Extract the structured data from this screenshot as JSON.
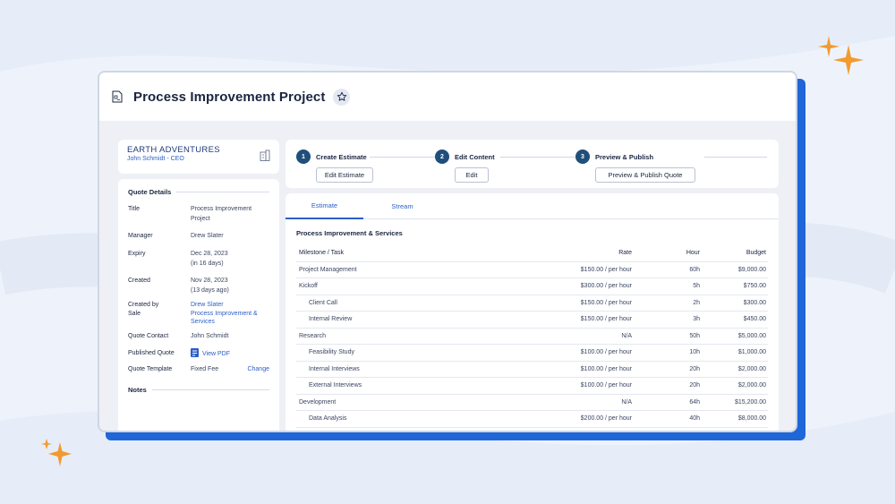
{
  "page": {
    "title": "Process Improvement Project",
    "colors": {
      "accent": "#2b5fc7",
      "shadow": "#1f66d9",
      "sparkle": "#f29a2e",
      "step": "#1f4f7a"
    }
  },
  "company": {
    "name": "EARTH ADVENTURES",
    "contact": "John Schmidt - CEO"
  },
  "quote_details": {
    "heading": "Quote Details",
    "rows": [
      {
        "label": "Title",
        "value": "Process Improvement",
        "value2": "Project"
      },
      {
        "label": "Manager",
        "value": "Drew Slater"
      },
      {
        "label": "Expiry",
        "value": "Dec 28, 2023",
        "value2": "(in 16 days)"
      },
      {
        "label": "Created",
        "value": "Nov 28, 2023",
        "value2": "(13 days ago)"
      },
      {
        "label": "Created by",
        "value": "Drew Slater"
      },
      {
        "label": "Sale",
        "value": "Process Improvement &",
        "value2": "Services"
      },
      {
        "label": "Quote Contact",
        "value": "John Schmidt"
      },
      {
        "label": "Published Quote",
        "value": "View PDF"
      },
      {
        "label": "Quote Template",
        "value": "Fixed Fee",
        "action": "Change"
      }
    ],
    "notes_heading": "Notes"
  },
  "steps": [
    {
      "num": "1",
      "title": "Create Estimate",
      "button": "Edit Estimate"
    },
    {
      "num": "2",
      "title": "Edit Content",
      "button": "Edit"
    },
    {
      "num": "3",
      "title": "Preview & Publish",
      "button": "Preview & Publish Quote"
    }
  ],
  "tabs": [
    {
      "label": "Estimate",
      "active": true
    },
    {
      "label": "Stream",
      "active": false
    }
  ],
  "estimate": {
    "title": "Process Improvement & Services",
    "columns": [
      "Milestone / Task",
      "Rate",
      "Hour",
      "Budget"
    ],
    "rows": [
      {
        "task": "Project Management",
        "rate": "$150.00 / per hour",
        "hour": "60h",
        "budget": "$9,000.00",
        "indent": false
      },
      {
        "task": "Kickoff",
        "rate": "$300.00 / per hour",
        "hour": "5h",
        "budget": "$750.00",
        "indent": false
      },
      {
        "task": "Client Call",
        "rate": "$150.00 / per hour",
        "hour": "2h",
        "budget": "$300.00",
        "indent": true
      },
      {
        "task": "Internal Review",
        "rate": "$150.00 / per hour",
        "hour": "3h",
        "budget": "$450.00",
        "indent": true
      },
      {
        "task": "Research",
        "rate": "N/A",
        "hour": "50h",
        "budget": "$5,000.00",
        "indent": false
      },
      {
        "task": "Feasibility Study",
        "rate": "$100.00 / per hour",
        "hour": "10h",
        "budget": "$1,000.00",
        "indent": true
      },
      {
        "task": "Internal Interviews",
        "rate": "$100.00 / per hour",
        "hour": "20h",
        "budget": "$2,000.00",
        "indent": true
      },
      {
        "task": "External Interviews",
        "rate": "$100.00 / per hour",
        "hour": "20h",
        "budget": "$2,000.00",
        "indent": true
      },
      {
        "task": "Development",
        "rate": "N/A",
        "hour": "64h",
        "budget": "$15,200.00",
        "indent": false
      },
      {
        "task": "Data Analysis",
        "rate": "$200.00 / per hour",
        "hour": "40h",
        "budget": "$8,000.00",
        "indent": true
      }
    ]
  }
}
